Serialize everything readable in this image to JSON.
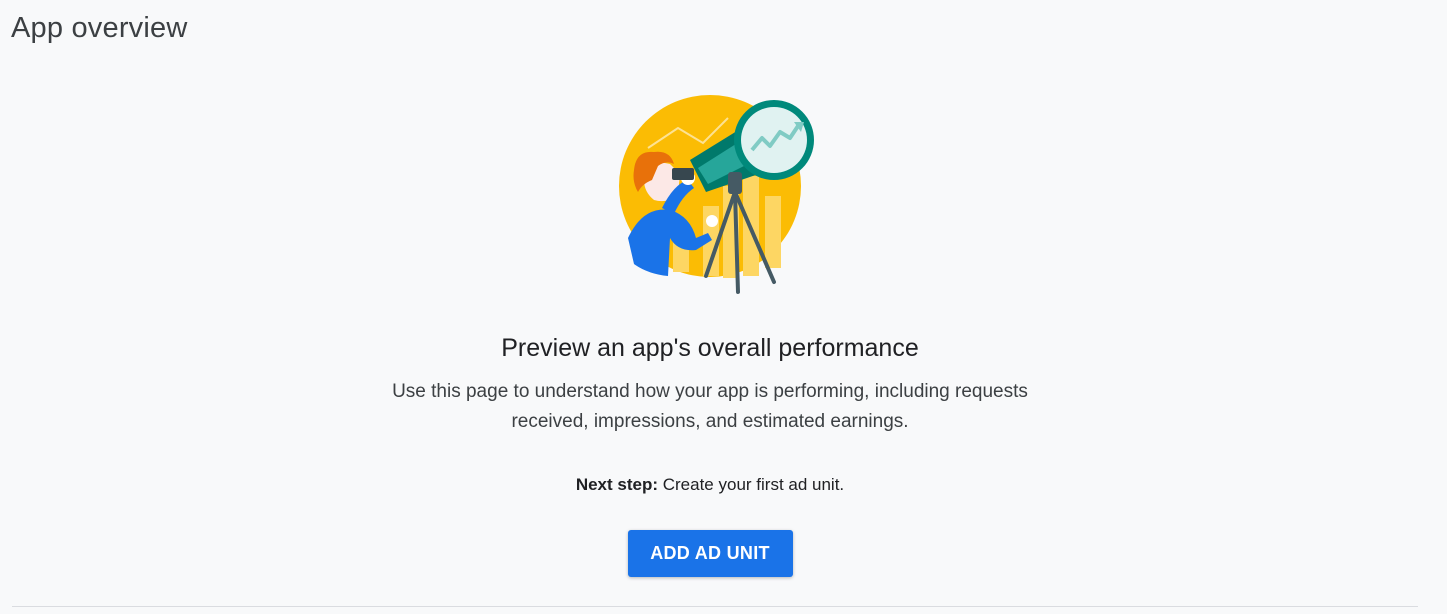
{
  "page": {
    "title": "App overview"
  },
  "empty_state": {
    "illustration": "telescope-performance-illustration",
    "headline": "Preview an app's overall performance",
    "description": "Use this page to understand how your app is performing, including requests received, impressions, and estimated earnings.",
    "next_step_label": "Next step:",
    "next_step_text": " Create your first ad unit.",
    "button_label": "ADD AD UNIT"
  },
  "colors": {
    "background": "#f8f9fa",
    "primary_button": "#1a73e8",
    "illustration_yellow": "#fbbc04",
    "telescope_teal": "#00897b"
  }
}
